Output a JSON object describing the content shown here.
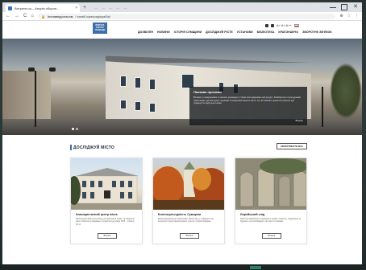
{
  "browser": {
    "tab_title": "Витрати.ua – Апорія оборон...",
    "tab_close": "×",
    "tab_new": "+",
    "tabbar_mid": "— — — — —",
    "url_host": "Іпонаведрогасом",
    "url_path": "/ smaill.ісрасредікраї/Ікі/",
    "nav_back": "←",
    "nav_forward": "→",
    "nav_reload": "C",
    "nav_home": "⌂",
    "addr_icons": [
      "⊕",
      "☆",
      "⋮"
    ]
  },
  "site": {
    "logo_text": "ВІЗИТНА КАРТКА ГРОМАДИ",
    "lang": "A+ A+ A++",
    "nav": [
      "ДОЗВІЛЛЯ",
      "НОВИНИ",
      "ІСТОРІЯ СУМЩИНИ",
      "ДОСЛІДЖУЙ РІСТЕ",
      "УСТАНОВИ",
      "БІБЛІОТЕКА",
      "КРАЄЗНАВЧО",
      "ЗВОРОТНЄ ЗВ'ЯЗОК"
    ]
  },
  "hero": {
    "card_title": "Ласкаво просимо",
    "card_text": "Вітаємо з поверненням та нашою громадою, історію якої відкриває цей ресурс. Знайомтеся з культурними пам'ятками, архітектурою, музеями й галереями нашого міста. Тут ви зможете дізнатися більше про традиції та події цього краю.",
    "card_more": "Більше"
  },
  "explore": {
    "title": "ДОСЛІДЖУЙ МІСТО",
    "all_button": "ПЕРЕГЛЯНУТИ ВСЕ",
    "cards": [
      {
        "title": "Класицистичний центр міста",
        "text": "Пропонуємо вам прогулянку центром міста Суми, що зберегло своє історичне планування та архітектуру кінця XVIII – початку ХХ ст.",
        "button": "Більше"
      },
      {
        "title": "Богатокультурність Сумщини",
        "text": "Багатонаціональна історія краю збереглась у спадщині, яку залишили представники різних культур та віросповідань.",
        "button": "Більше"
      },
      {
        "title": "Єврейський слід",
        "text": "Пам'ятки єврейської спадщини в Сумах: синагоги, кладовища та будинки, що розповідають про життя громади.",
        "button": "Більше"
      }
    ]
  },
  "colors": {
    "accent": "#3d6fa8",
    "title": "#1d2a3a"
  }
}
